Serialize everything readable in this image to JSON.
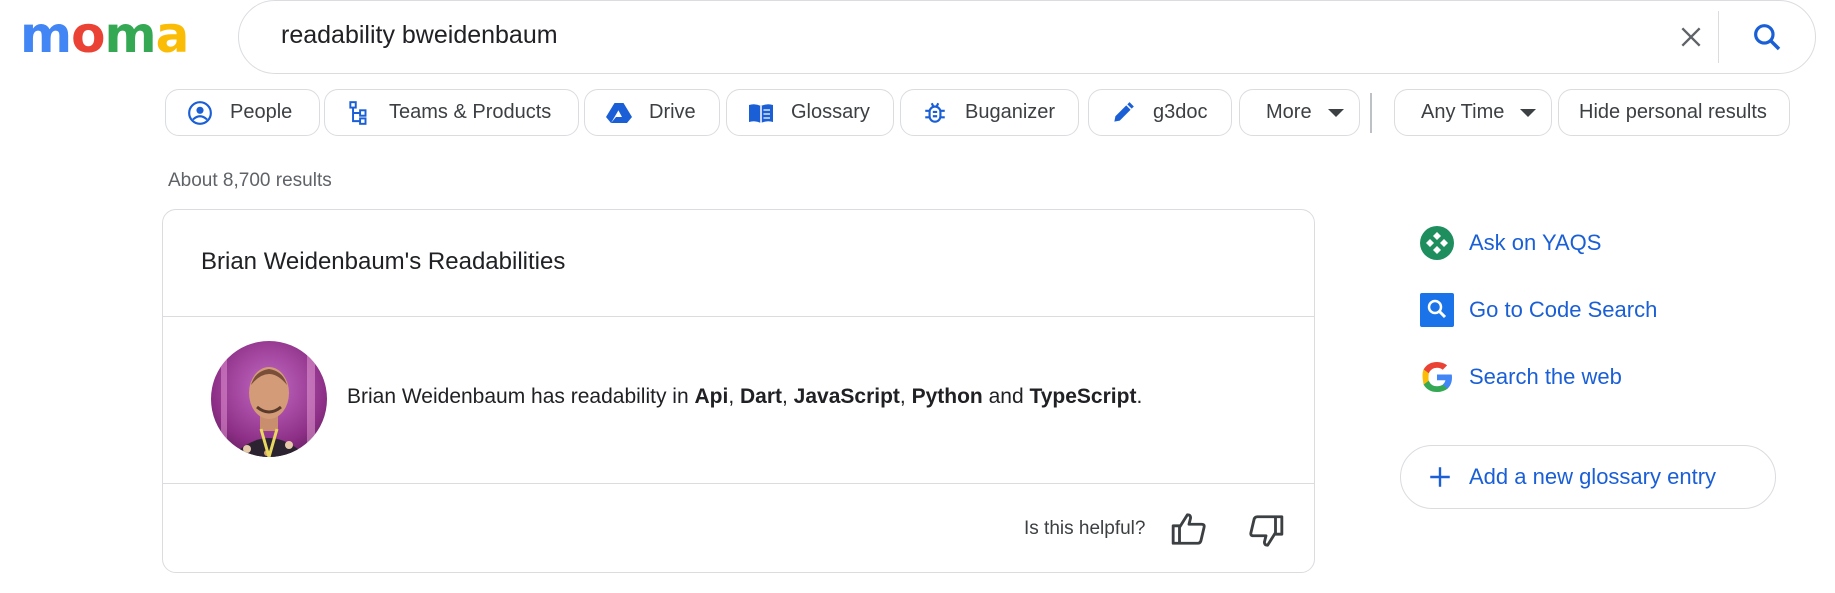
{
  "logo": {
    "letters": [
      "m",
      "o",
      "m",
      "a"
    ],
    "colors": [
      "#4285f4",
      "#ea4335",
      "#34a853",
      "#fbbc05"
    ]
  },
  "search": {
    "query": "readability bweidenbaum",
    "clear_icon": "close-icon",
    "search_icon": "search-icon"
  },
  "filters": [
    {
      "label": "People",
      "icon": "person-circle-icon"
    },
    {
      "label": "Teams & Products",
      "icon": "org-tree-icon"
    },
    {
      "label": "Drive",
      "icon": "drive-icon"
    },
    {
      "label": "Glossary",
      "icon": "book-icon"
    },
    {
      "label": "Buganizer",
      "icon": "bug-icon"
    },
    {
      "label": "g3doc",
      "icon": "pen-icon"
    },
    {
      "label": "More",
      "icon": "caret-down-icon"
    }
  ],
  "time_filter": {
    "label": "Any Time"
  },
  "hide_personal": {
    "label": "Hide personal results"
  },
  "result_count": "About 8,700 results",
  "card": {
    "title": "Brian Weidenbaum's Readabilities",
    "desc_prefix": "Brian Weidenbaum has readability in ",
    "languages": [
      "Api",
      "Dart",
      "JavaScript",
      "Python",
      "TypeScript"
    ],
    "sep_comma": ", ",
    "sep_and": " and ",
    "desc_end": ".",
    "helpful_label": "Is this helpful?"
  },
  "side": {
    "links": [
      {
        "label": "Ask on YAQS",
        "icon": "yaqs-icon"
      },
      {
        "label": "Go to Code Search",
        "icon": "code-search-icon"
      },
      {
        "label": "Search the web",
        "icon": "google-g-icon"
      }
    ],
    "add_button": "Add a new glossary entry"
  },
  "colors": {
    "accent": "#1a5fd6",
    "border": "#dadce0"
  }
}
